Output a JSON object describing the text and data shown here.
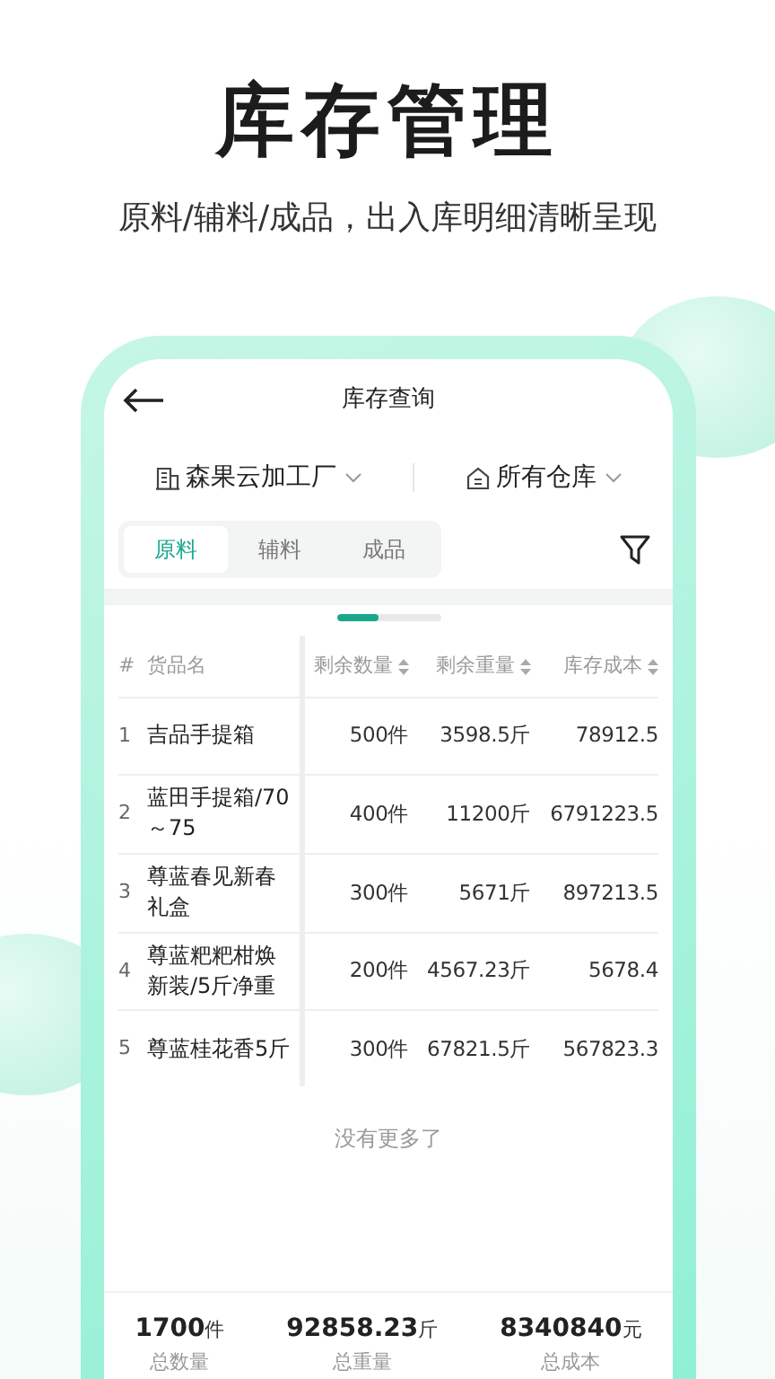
{
  "heading": "库存管理",
  "subheading": "原料/辅料/成品，出入库明细清晰呈现",
  "screen": {
    "title": "库存查询",
    "factory": "森果云加工厂",
    "warehouse": "所有仓库",
    "tabs": [
      {
        "label": "原料",
        "selected": true
      },
      {
        "label": "辅料",
        "selected": false
      },
      {
        "label": "成品",
        "selected": false
      }
    ],
    "table": {
      "columns": [
        {
          "label": "#",
          "sortable": false
        },
        {
          "label": "货品名",
          "sortable": false
        },
        {
          "label": "剩余数量",
          "sortable": true
        },
        {
          "label": "剩余重量",
          "sortable": true
        },
        {
          "label": "库存成本",
          "sortable": true
        }
      ],
      "rows": [
        [
          "1",
          "吉品手提箱",
          "500件",
          "3598.5斤",
          "78912.5"
        ],
        [
          "2",
          "蓝田手提箱/70～75",
          "400件",
          "11200斤",
          "6791223.5"
        ],
        [
          "3",
          "尊蓝春见新春礼盒",
          "300件",
          "5671斤",
          "897213.5"
        ],
        [
          "4",
          "尊蓝粑粑柑焕新装/5斤净重",
          "200件",
          "4567.23斤",
          "5678.4"
        ],
        [
          "5",
          "尊蓝桂花香5斤",
          "300件",
          "67821.5斤",
          "567823.3"
        ]
      ]
    },
    "end_note": "没有更多了",
    "totals": [
      {
        "value": "1700",
        "unit": "件",
        "label": "总数量"
      },
      {
        "value": "92858.23",
        "unit": "斤",
        "label": "总重量"
      },
      {
        "value": "8340840",
        "unit": "元",
        "label": "总成本"
      }
    ]
  }
}
